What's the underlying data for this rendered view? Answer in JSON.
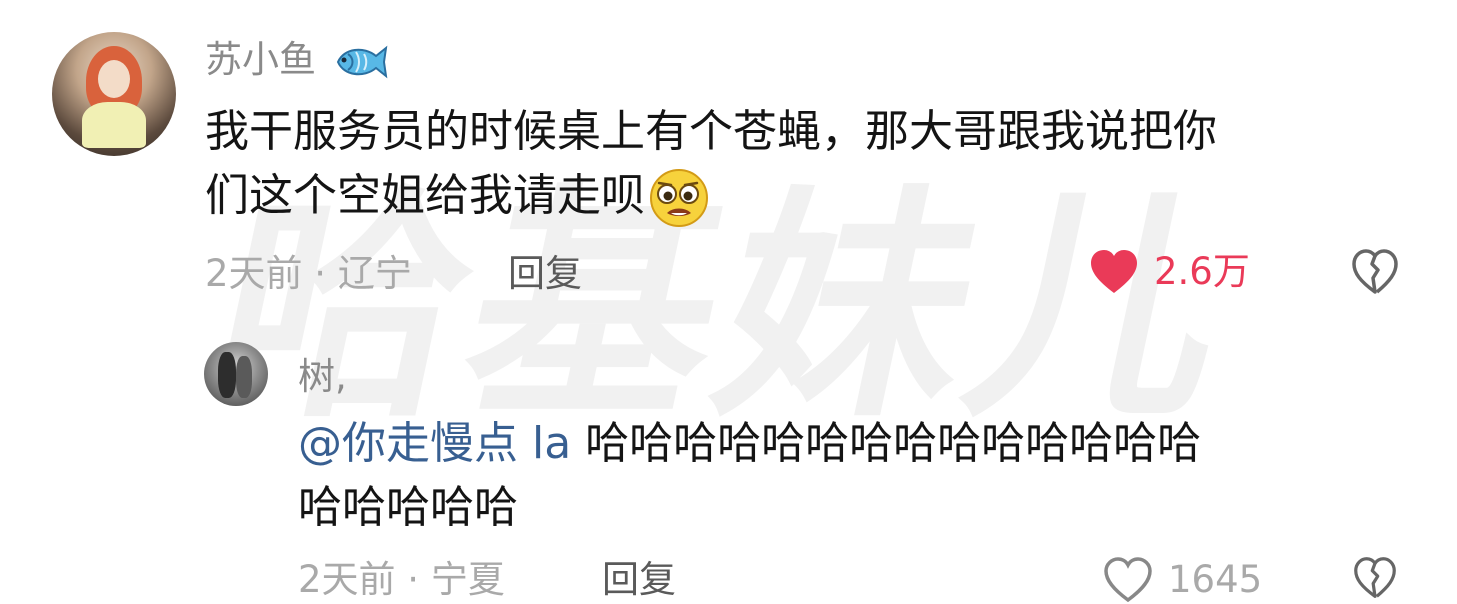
{
  "watermark": {
    "text": "哈基妹儿"
  },
  "comment": {
    "username": "苏小鱼",
    "text_lines": [
      "我干服务员的时候桌上有个苍蝇，那大哥跟我说把你",
      "们这个空姐给我请走呗"
    ],
    "emoji": "pleading-face-icon",
    "meta": "2天前 · 辽宁",
    "reply_label": "回复",
    "likes": "2.6万",
    "liked": true,
    "colors": {
      "like_active": "#ea3a58",
      "text": "#141414",
      "meta": "#a9a9a9"
    }
  },
  "reply": {
    "username": "树,",
    "mention": "@你走慢点 la",
    "text_line1": " 哈哈哈哈哈哈哈哈哈哈哈哈哈哈",
    "text_line2": "哈哈哈哈哈",
    "meta": "2天前 · 宁夏",
    "reply_label": "回复",
    "likes": "1645",
    "liked": false,
    "colors": {
      "mention": "#385f91"
    }
  }
}
